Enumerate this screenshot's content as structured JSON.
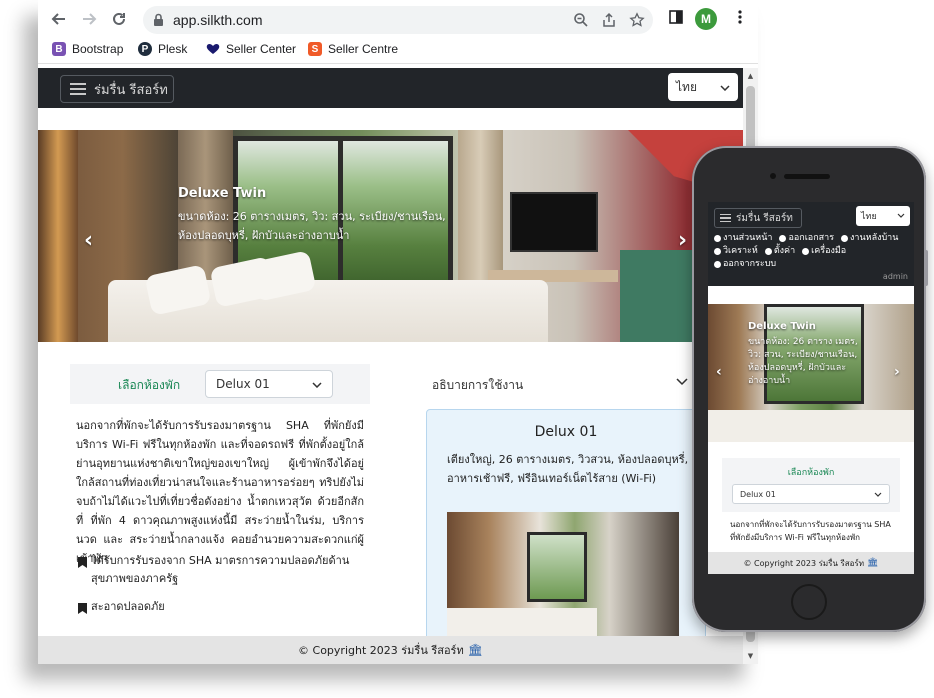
{
  "browser": {
    "url": "app.silkth.com",
    "profile_initial": "M",
    "bookmarks": [
      {
        "label": "Bootstrap",
        "icon": "bootstrap-icon",
        "color": "#7952b3"
      },
      {
        "label": "Plesk",
        "icon": "plesk-icon",
        "color": "#1f2d3d"
      },
      {
        "label": "Seller Center",
        "icon": "seller-center-icon",
        "color": "#1a1a6e"
      },
      {
        "label": "Seller Centre",
        "icon": "seller-centre-icon",
        "color": "#f05a28"
      }
    ]
  },
  "site": {
    "brand": "ร่มรื่น รีสอร์ท",
    "language": "ไทย",
    "hero": {
      "title": "Deluxe Twin",
      "description": "ขนาดห้อง: 26 ตารางเมตร, วิว: สวน, ระเบียง/ชานเรือน, ห้องปลอดบุหรี่, ฝักบัวและอ่างอาบน้ำ"
    },
    "room_select": {
      "label": "เลือกห้องพัก",
      "value": "Delux 01"
    },
    "intro_text": "นอกจากที่พักจะได้รับการรับรองมาตรฐาน SHA ที่พักยังมีบริการ Wi-Fi ฟรีในทุกห้องพัก และที่จอดรถฟรี ที่พักตั้งอยู่ใกล้ย่านอุทยานแห่งชาติเขาใหญ่ของเขาใหญ่ ผู้เข้าพักจึงได้อยู่ใกล้สถานที่ท่องเที่ยวน่าสนใจและร้านอาหารอร่อยๆ ทริปยังไม่จบถ้าไม่ได้แวะไปที่เที่ยวชื่อดังอย่าง น้ำตกเหวสุวัต ด้วยอีกสักที่ ที่พัก 4 ดาวคุณภาพสูงแห่งนี้มี สระว่ายน้ำในร่ม, บริการนวด และ สระว่ายน้ำกลางแจ้ง คอยอำนวยความสะดวกแก่ผู้เข้าพัก",
    "features": [
      "ได้รับการรับรองจาก SHA มาตรการความปลอดภัยด้านสุขภาพของภาครัฐ",
      "สะอาดปลอดภัย"
    ],
    "usage_heading": "อธิบายการใช้งาน",
    "card": {
      "title": "Delux 01",
      "description": "เตียงใหญ่, 26 ตารางเมตร, วิวสวน, ห้องปลอดบุหรี่, อาหารเช้าฟรี, ฟรีอินเทอร์เน็ตไร้สาย (Wi-Fi)"
    },
    "footer": "© Copyright 2023 ร่มรื่น รีสอร์ท"
  },
  "mobile": {
    "brand": "ร่มรื่น รีสอร์ท",
    "language": "ไทย",
    "menu": [
      "งานส่วนหน้า",
      "ออกเอกสาร",
      "งานหลังบ้าน",
      "วิเคราะห์",
      "ตั้งค่า",
      "เครื่องมือ",
      "ออกจากระบบ"
    ],
    "user": "admin",
    "hero_title": "Deluxe Twin",
    "hero_description": "ขนาดห้อง: 26 ตาราง เมตร, วิว: สวน, ระเบียง/ชานเรือน, ห้องปลอดบุหรี่, ฝักบัวและอ่างอาบน้ำ",
    "room_label": "เลือกห้องพัก",
    "room_value": "Delux 01",
    "intro_text": "นอกจากที่พักจะได้รับการรับรองมาตรฐาน SHA ที่พักยังมีบริการ Wi-Fi ฟรีในทุกห้องพัก",
    "footer": "© Copyright 2023 ร่มรื่น รีสอร์ท"
  }
}
